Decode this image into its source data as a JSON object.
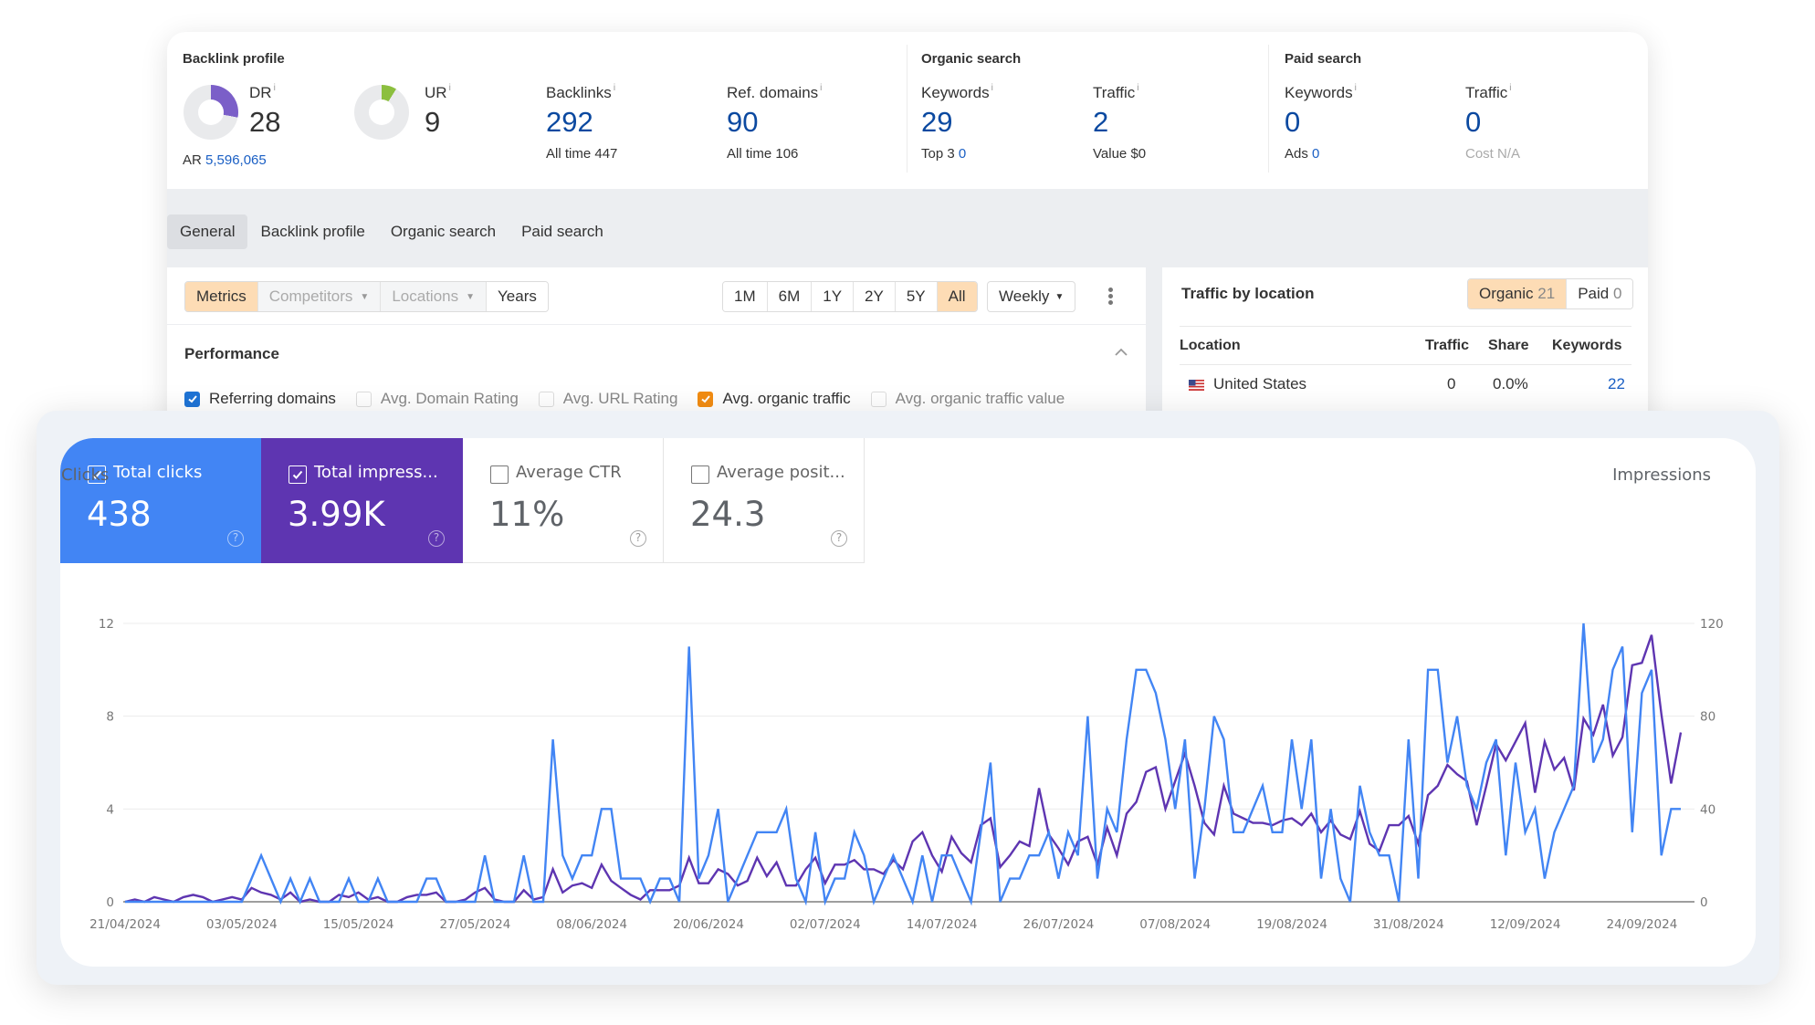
{
  "backlink_profile": {
    "title": "Backlink profile",
    "dr": {
      "label": "DR",
      "value": "28",
      "rating_fraction": 0.28,
      "color": "#7b5fc8"
    },
    "ur": {
      "label": "UR",
      "value": "9",
      "rating_fraction": 0.09,
      "color": "#8cbf3f"
    },
    "ar": {
      "label": "AR",
      "value": "5,596,065"
    },
    "backlinks": {
      "label": "Backlinks",
      "value": "292",
      "sub_label": "All time",
      "sub_value": "447"
    },
    "ref_domains": {
      "label": "Ref. domains",
      "value": "90",
      "sub_label": "All time",
      "sub_value": "106"
    },
    "info_glyph": "i"
  },
  "organic_search": {
    "title": "Organic search",
    "keywords": {
      "label": "Keywords",
      "value": "29",
      "sub_label": "Top 3",
      "sub_value": "0"
    },
    "traffic": {
      "label": "Traffic",
      "value": "2",
      "sub_label": "Value",
      "sub_value": "$0"
    }
  },
  "paid_search": {
    "title": "Paid search",
    "keywords": {
      "label": "Keywords",
      "value": "0",
      "sub_label": "Ads",
      "sub_value": "0"
    },
    "traffic": {
      "label": "Traffic",
      "value": "0",
      "sub_label": "Cost",
      "sub_value": "N/A"
    }
  },
  "tabs": [
    {
      "label": "General",
      "active": true
    },
    {
      "label": "Backlink profile",
      "active": false
    },
    {
      "label": "Organic search",
      "active": false
    },
    {
      "label": "Paid search",
      "active": false
    }
  ],
  "toolbar": {
    "modes": [
      {
        "label": "Metrics",
        "selected": true
      },
      {
        "label": "Competitors",
        "selected": false,
        "dropdown": true
      },
      {
        "label": "Locations",
        "selected": false,
        "dropdown": true
      },
      {
        "label": "Years",
        "selected": false
      }
    ],
    "ranges": [
      "1M",
      "6M",
      "1Y",
      "2Y",
      "5Y",
      "All"
    ],
    "selected_range": "All",
    "interval": "Weekly",
    "more_icon": "kebab-menu-icon"
  },
  "performance": {
    "title": "Performance",
    "collapse_icon": "chevron-up-icon",
    "metrics": [
      {
        "label": "Referring domains",
        "checked": true,
        "color": "#1f74d6"
      },
      {
        "label": "Avg. Domain Rating",
        "checked": false
      },
      {
        "label": "Avg. URL Rating",
        "checked": false
      },
      {
        "label": "Avg. organic traffic",
        "checked": true,
        "color": "#f28c12"
      },
      {
        "label": "Avg. organic traffic value",
        "checked": false
      }
    ]
  },
  "traffic_by_location": {
    "title": "Traffic by location",
    "toggle": [
      {
        "label": "Organic",
        "count": "21",
        "selected": true
      },
      {
        "label": "Paid",
        "count": "0",
        "selected": false
      }
    ],
    "columns": [
      "Location",
      "Traffic",
      "Share",
      "Keywords"
    ],
    "rows": [
      {
        "flag": "us-flag-icon",
        "location": "United States",
        "traffic": "0",
        "share": "0.0%",
        "keywords": "22"
      }
    ]
  },
  "search_console": {
    "tiles": [
      {
        "label": "Total clicks",
        "value": "438",
        "checked": true,
        "color": "#4285f4"
      },
      {
        "label": "Total impress...",
        "value": "3.99K",
        "checked": true,
        "color": "#5e35b1"
      },
      {
        "label": "Average CTR",
        "value": "11%",
        "checked": false
      },
      {
        "label": "Average posit...",
        "value": "24.3",
        "checked": false
      }
    ],
    "help_glyph": "?"
  },
  "chart_data": {
    "type": "line",
    "title": "",
    "xlabel": "",
    "ylabel": "Clicks",
    "ylabel_right": "Impressions",
    "ylim": [
      0,
      12
    ],
    "ylim_right": [
      0,
      120
    ],
    "yticks": [
      "0",
      "4",
      "8",
      "12"
    ],
    "yticks_right": [
      "0",
      "40",
      "80",
      "120"
    ],
    "grid": true,
    "x_start": "21/04/2024",
    "x_tick_every_days": 12,
    "x_ticks": [
      "21/04/2024",
      "03/05/2024",
      "15/05/2024",
      "27/05/2024",
      "08/06/2024",
      "20/06/2024",
      "02/07/2024",
      "14/07/2024",
      "26/07/2024",
      "07/08/2024",
      "19/08/2024",
      "31/08/2024",
      "12/09/2024",
      "24/09/2024"
    ],
    "series": [
      {
        "name": "Clicks",
        "axis": "left",
        "color": "#4285f4",
        "values": [
          0,
          0,
          0,
          0,
          0,
          0,
          0,
          0,
          0,
          0,
          0,
          0,
          0,
          1,
          2,
          1,
          0,
          1,
          0,
          1,
          0,
          0,
          0,
          1,
          0,
          0,
          1,
          0,
          0,
          0,
          0,
          1,
          1,
          0,
          0,
          0,
          0,
          2,
          0,
          0,
          0,
          2,
          0,
          0,
          7,
          2,
          1,
          2,
          2,
          4,
          4,
          1,
          1,
          1,
          0,
          1,
          1,
          0,
          11,
          1,
          2,
          4,
          0,
          1,
          2,
          3,
          3,
          3,
          4,
          1,
          0,
          3,
          0,
          1,
          1,
          3,
          2,
          0,
          1,
          2,
          1,
          0,
          2,
          0,
          2,
          2,
          1,
          0,
          3,
          6,
          0,
          1,
          1,
          2,
          2,
          3,
          1,
          3,
          2,
          8,
          1,
          4,
          3,
          7,
          10,
          10,
          9,
          7,
          4,
          7,
          1,
          4,
          8,
          7,
          3,
          3,
          4,
          5,
          3,
          3,
          7,
          4,
          7,
          1,
          4,
          1,
          0,
          5,
          3,
          2,
          2,
          0,
          7,
          1,
          10,
          10,
          6,
          8,
          5,
          4,
          6,
          7,
          2,
          6,
          3,
          4,
          1,
          3,
          4,
          5,
          12,
          6,
          7,
          10,
          11,
          3,
          9,
          10,
          2,
          4,
          4
        ]
      },
      {
        "name": "Impressions",
        "axis": "right",
        "color": "#5e35b1",
        "values": [
          0,
          1,
          0,
          2,
          1,
          0,
          2,
          3,
          2,
          0,
          1,
          2,
          1,
          6,
          4,
          3,
          1,
          4,
          0,
          1,
          0,
          0,
          3,
          2,
          4,
          1,
          2,
          0,
          0,
          2,
          3,
          3,
          4,
          0,
          0,
          1,
          4,
          6,
          1,
          0,
          0,
          5,
          1,
          2,
          14,
          4,
          7,
          8,
          6,
          16,
          9,
          6,
          3,
          1,
          5,
          5,
          5,
          7,
          19,
          8,
          8,
          14,
          12,
          7,
          9,
          19,
          11,
          17,
          7,
          7,
          14,
          19,
          8,
          16,
          16,
          18,
          14,
          14,
          12,
          18,
          14,
          26,
          30,
          20,
          13,
          28,
          21,
          17,
          33,
          36,
          15,
          20,
          26,
          24,
          49,
          29,
          23,
          16,
          26,
          28,
          16,
          32,
          20,
          38,
          43,
          56,
          58,
          40,
          52,
          64,
          50,
          34,
          29,
          50,
          38,
          36,
          34,
          34,
          33,
          35,
          36,
          33,
          38,
          30,
          35,
          29,
          27,
          39,
          25,
          22,
          33,
          33,
          37,
          25,
          46,
          50,
          59,
          55,
          52,
          33,
          50,
          68,
          61,
          69,
          77,
          47,
          69,
          57,
          62,
          48,
          79,
          72,
          85,
          63,
          71,
          102,
          103,
          115,
          81,
          51,
          73
        ]
      }
    ]
  }
}
